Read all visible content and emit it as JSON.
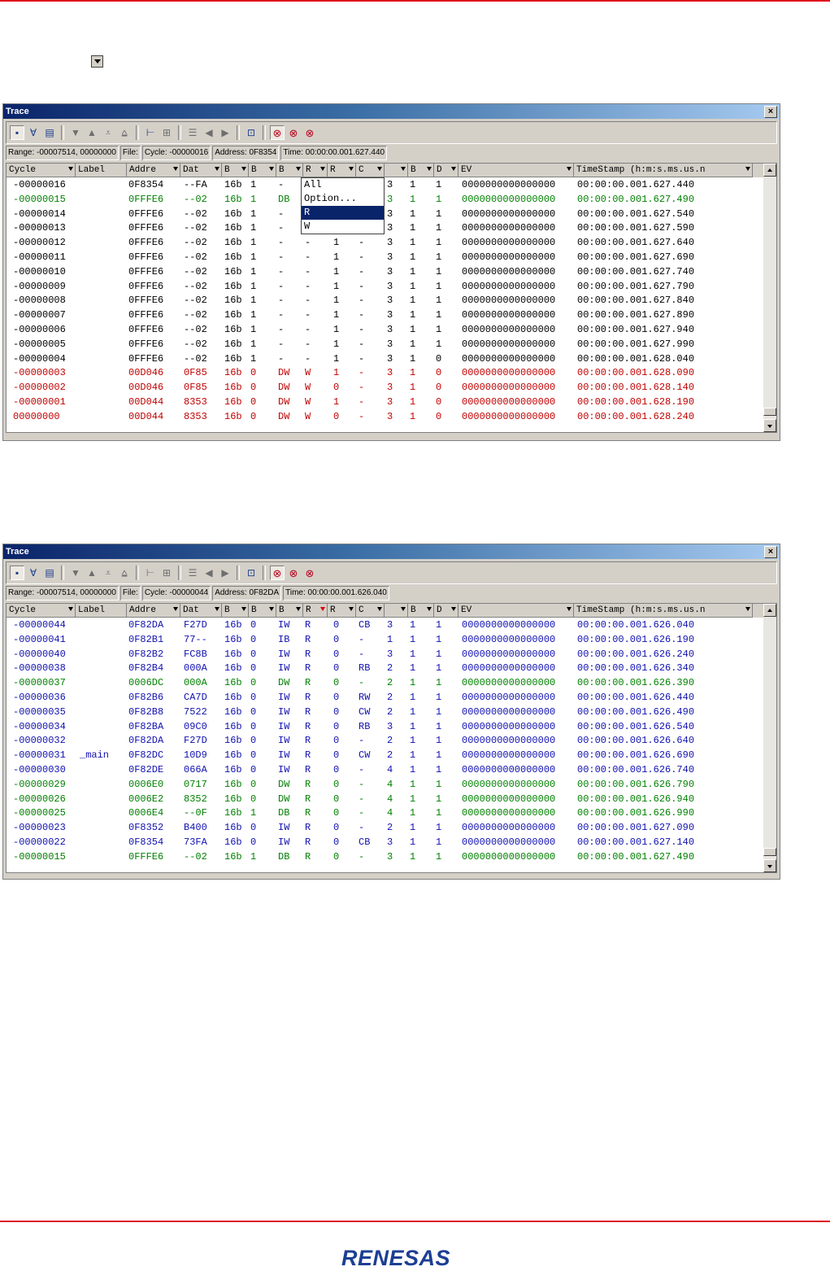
{
  "windows": [
    {
      "title": "Trace",
      "status": {
        "range": "Range: -00007514,  00000000",
        "file": "File:",
        "cycle": "Cycle: -00000016",
        "address": "Address: 0F8354",
        "time": "Time: 00:00:00.001.627.440"
      },
      "headers": [
        "Cycle",
        "Label",
        "Addre",
        "Dat",
        "B",
        "B",
        "B",
        "R",
        "R",
        "C",
        "",
        "B",
        "D",
        "EV",
        "TimeStamp (h:m:s.ms.us.n"
      ],
      "rows": [
        {
          "c": "#000000",
          "v": [
            "-00000016",
            "",
            "0F8354",
            "--FA",
            "16b",
            "1",
            "-",
            "",
            "",
            "",
            "3",
            "1",
            "1",
            "0000000000000000",
            "00:00:00.001.627.440"
          ]
        },
        {
          "c": "#008000",
          "v": [
            "-00000015",
            "",
            "0FFFE6",
            "--02",
            "16b",
            "1",
            "DB",
            "",
            "",
            "",
            "3",
            "1",
            "1",
            "0000000000000000",
            "00:00:00.001.627.490"
          ]
        },
        {
          "c": "#000000",
          "v": [
            "-00000014",
            "",
            "0FFFE6",
            "--02",
            "16b",
            "1",
            "-",
            "",
            "",
            "",
            "3",
            "1",
            "1",
            "0000000000000000",
            "00:00:00.001.627.540"
          ]
        },
        {
          "c": "#000000",
          "v": [
            "-00000013",
            "",
            "0FFFE6",
            "--02",
            "16b",
            "1",
            "-",
            "",
            "",
            "",
            "3",
            "1",
            "1",
            "0000000000000000",
            "00:00:00.001.627.590"
          ]
        },
        {
          "c": "#000000",
          "v": [
            "-00000012",
            "",
            "0FFFE6",
            "--02",
            "16b",
            "1",
            "-",
            "-",
            "1",
            "-",
            "3",
            "1",
            "1",
            "0000000000000000",
            "00:00:00.001.627.640"
          ]
        },
        {
          "c": "#000000",
          "v": [
            "-00000011",
            "",
            "0FFFE6",
            "--02",
            "16b",
            "1",
            "-",
            "-",
            "1",
            "-",
            "3",
            "1",
            "1",
            "0000000000000000",
            "00:00:00.001.627.690"
          ]
        },
        {
          "c": "#000000",
          "v": [
            "-00000010",
            "",
            "0FFFE6",
            "--02",
            "16b",
            "1",
            "-",
            "-",
            "1",
            "-",
            "3",
            "1",
            "1",
            "0000000000000000",
            "00:00:00.001.627.740"
          ]
        },
        {
          "c": "#000000",
          "v": [
            "-00000009",
            "",
            "0FFFE6",
            "--02",
            "16b",
            "1",
            "-",
            "-",
            "1",
            "-",
            "3",
            "1",
            "1",
            "0000000000000000",
            "00:00:00.001.627.790"
          ]
        },
        {
          "c": "#000000",
          "v": [
            "-00000008",
            "",
            "0FFFE6",
            "--02",
            "16b",
            "1",
            "-",
            "-",
            "1",
            "-",
            "3",
            "1",
            "1",
            "0000000000000000",
            "00:00:00.001.627.840"
          ]
        },
        {
          "c": "#000000",
          "v": [
            "-00000007",
            "",
            "0FFFE6",
            "--02",
            "16b",
            "1",
            "-",
            "-",
            "1",
            "-",
            "3",
            "1",
            "1",
            "0000000000000000",
            "00:00:00.001.627.890"
          ]
        },
        {
          "c": "#000000",
          "v": [
            "-00000006",
            "",
            "0FFFE6",
            "--02",
            "16b",
            "1",
            "-",
            "-",
            "1",
            "-",
            "3",
            "1",
            "1",
            "0000000000000000",
            "00:00:00.001.627.940"
          ]
        },
        {
          "c": "#000000",
          "v": [
            "-00000005",
            "",
            "0FFFE6",
            "--02",
            "16b",
            "1",
            "-",
            "-",
            "1",
            "-",
            "3",
            "1",
            "1",
            "0000000000000000",
            "00:00:00.001.627.990"
          ]
        },
        {
          "c": "#000000",
          "v": [
            "-00000004",
            "",
            "0FFFE6",
            "--02",
            "16b",
            "1",
            "-",
            "-",
            "1",
            "-",
            "3",
            "1",
            "0",
            "0000000000000000",
            "00:00:00.001.628.040"
          ]
        },
        {
          "c": "#c00000",
          "v": [
            "-00000003",
            "",
            "00D046",
            "0F85",
            "16b",
            "0",
            "DW",
            "W",
            "1",
            "-",
            "3",
            "1",
            "0",
            "0000000000000000",
            "00:00:00.001.628.090"
          ]
        },
        {
          "c": "#c00000",
          "v": [
            "-00000002",
            "",
            "00D046",
            "0F85",
            "16b",
            "0",
            "DW",
            "W",
            "0",
            "-",
            "3",
            "1",
            "0",
            "0000000000000000",
            "00:00:00.001.628.140"
          ]
        },
        {
          "c": "#c00000",
          "v": [
            "-00000001",
            "",
            "00D044",
            "8353",
            "16b",
            "0",
            "DW",
            "W",
            "1",
            "-",
            "3",
            "1",
            "0",
            "0000000000000000",
            "00:00:00.001.628.190"
          ]
        },
        {
          "c": "#c00000",
          "v": [
            " 00000000",
            "",
            "00D044",
            "8353",
            "16b",
            "0",
            "DW",
            "W",
            "0",
            "-",
            "3",
            "1",
            "0",
            "0000000000000000",
            "00:00:00.001.628.240"
          ]
        }
      ],
      "menu": {
        "items": [
          "All",
          "Option...",
          "R",
          "W"
        ],
        "selected": 2
      }
    },
    {
      "title": "Trace",
      "status": {
        "range": "Range: -00007514,  00000000",
        "file": "File:",
        "cycle": "Cycle: -00000044",
        "address": "Address: 0F82DA",
        "time": "Time: 00:00:00.001.626.040"
      },
      "headers": [
        "Cycle",
        "Label",
        "Addre",
        "Dat",
        "B",
        "B",
        "B",
        "R",
        "R",
        "C",
        "",
        "B",
        "D",
        "EV",
        "TimeStamp (h:m:s.ms.us.n"
      ],
      "rows": [
        {
          "c": "#1010b0",
          "v": [
            "-00000044",
            "",
            "0F82DA",
            "F27D",
            "16b",
            "0",
            "IW",
            "R",
            "0",
            "CB",
            "3",
            "1",
            "1",
            "0000000000000000",
            "00:00:00.001.626.040"
          ]
        },
        {
          "c": "#1010b0",
          "v": [
            "-00000041",
            "",
            "0F82B1",
            "77--",
            "16b",
            "0",
            "IB",
            "R",
            "0",
            "-",
            "1",
            "1",
            "1",
            "0000000000000000",
            "00:00:00.001.626.190"
          ]
        },
        {
          "c": "#1010b0",
          "v": [
            "-00000040",
            "",
            "0F82B2",
            "FC8B",
            "16b",
            "0",
            "IW",
            "R",
            "0",
            "-",
            "3",
            "1",
            "1",
            "0000000000000000",
            "00:00:00.001.626.240"
          ]
        },
        {
          "c": "#1010b0",
          "v": [
            "-00000038",
            "",
            "0F82B4",
            "000A",
            "16b",
            "0",
            "IW",
            "R",
            "0",
            "RB",
            "2",
            "1",
            "1",
            "0000000000000000",
            "00:00:00.001.626.340"
          ]
        },
        {
          "c": "#008000",
          "v": [
            "-00000037",
            "",
            "0006DC",
            "000A",
            "16b",
            "0",
            "DW",
            "R",
            "0",
            "-",
            "2",
            "1",
            "1",
            "0000000000000000",
            "00:00:00.001.626.390"
          ]
        },
        {
          "c": "#1010b0",
          "v": [
            "-00000036",
            "",
            "0F82B6",
            "CA7D",
            "16b",
            "0",
            "IW",
            "R",
            "0",
            "RW",
            "2",
            "1",
            "1",
            "0000000000000000",
            "00:00:00.001.626.440"
          ]
        },
        {
          "c": "#1010b0",
          "v": [
            "-00000035",
            "",
            "0F82B8",
            "7522",
            "16b",
            "0",
            "IW",
            "R",
            "0",
            "CW",
            "2",
            "1",
            "1",
            "0000000000000000",
            "00:00:00.001.626.490"
          ]
        },
        {
          "c": "#1010b0",
          "v": [
            "-00000034",
            "",
            "0F82BA",
            "09C0",
            "16b",
            "0",
            "IW",
            "R",
            "0",
            "RB",
            "3",
            "1",
            "1",
            "0000000000000000",
            "00:00:00.001.626.540"
          ]
        },
        {
          "c": "#1010b0",
          "v": [
            "-00000032",
            "",
            "0F82DA",
            "F27D",
            "16b",
            "0",
            "IW",
            "R",
            "0",
            "-",
            "2",
            "1",
            "1",
            "0000000000000000",
            "00:00:00.001.626.640"
          ]
        },
        {
          "c": "#1010b0",
          "v": [
            "-00000031",
            "_main",
            "0F82DC",
            "10D9",
            "16b",
            "0",
            "IW",
            "R",
            "0",
            "CW",
            "2",
            "1",
            "1",
            "0000000000000000",
            "00:00:00.001.626.690"
          ]
        },
        {
          "c": "#1010b0",
          "v": [
            "-00000030",
            "",
            "0F82DE",
            "066A",
            "16b",
            "0",
            "IW",
            "R",
            "0",
            "-",
            "4",
            "1",
            "1",
            "0000000000000000",
            "00:00:00.001.626.740"
          ]
        },
        {
          "c": "#008000",
          "v": [
            "-00000029",
            "",
            "0006E0",
            "0717",
            "16b",
            "0",
            "DW",
            "R",
            "0",
            "-",
            "4",
            "1",
            "1",
            "0000000000000000",
            "00:00:00.001.626.790"
          ]
        },
        {
          "c": "#008000",
          "v": [
            "-00000026",
            "",
            "0006E2",
            "8352",
            "16b",
            "0",
            "DW",
            "R",
            "0",
            "-",
            "4",
            "1",
            "1",
            "0000000000000000",
            "00:00:00.001.626.940"
          ]
        },
        {
          "c": "#008000",
          "v": [
            "-00000025",
            "",
            "0006E4",
            "--0F",
            "16b",
            "1",
            "DB",
            "R",
            "0",
            "-",
            "4",
            "1",
            "1",
            "0000000000000000",
            "00:00:00.001.626.990"
          ]
        },
        {
          "c": "#1010b0",
          "v": [
            "-00000023",
            "",
            "0F8352",
            "B400",
            "16b",
            "0",
            "IW",
            "R",
            "0",
            "-",
            "2",
            "1",
            "1",
            "0000000000000000",
            "00:00:00.001.627.090"
          ]
        },
        {
          "c": "#1010b0",
          "v": [
            "-00000022",
            "",
            "0F8354",
            "73FA",
            "16b",
            "0",
            "IW",
            "R",
            "0",
            "CB",
            "3",
            "1",
            "1",
            "0000000000000000",
            "00:00:00.001.627.140"
          ]
        },
        {
          "c": "#008000",
          "v": [
            "-00000015",
            "",
            "0FFFE6",
            "--02",
            "16b",
            "1",
            "DB",
            "R",
            "0",
            "-",
            "3",
            "1",
            "1",
            "0000000000000000",
            "00:00:00.001.627.490"
          ]
        }
      ]
    }
  ],
  "footer": {
    "logo": "RENESAS"
  },
  "colors": {
    "accent_rule": "#e0141e",
    "title_bar": "#0a246a"
  }
}
